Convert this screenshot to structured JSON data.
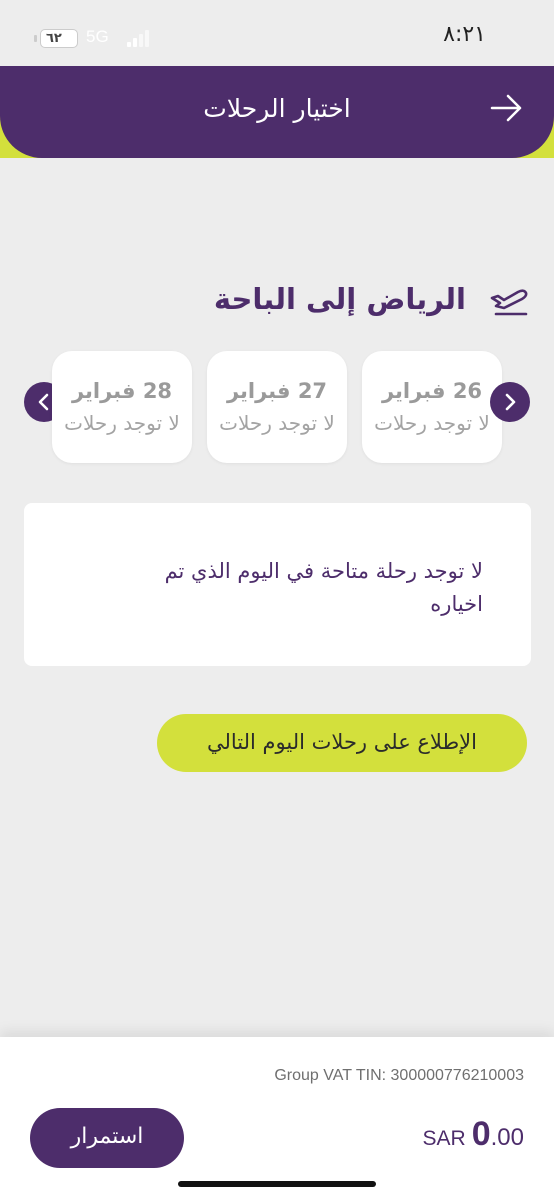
{
  "status_bar": {
    "time": "٨:٢١",
    "battery": "٦٢",
    "network": "5G"
  },
  "header": {
    "title": "اختيار الرحلات",
    "back_icon": "arrow-right-icon"
  },
  "route": {
    "title": "الرياض إلى الباحة",
    "icon": "plane-departure-icon"
  },
  "dates": [
    {
      "date": "26 فبراير",
      "status": "لا توجد رحلات"
    },
    {
      "date": "27 فبراير",
      "status": "لا توجد رحلات"
    },
    {
      "date": "28 فبراير",
      "status": "لا توجد رحلات"
    }
  ],
  "message": "لا توجد رحلة متاحة في اليوم الذي تم اخياره",
  "next_day_button": "الإطلاع على رحلات اليوم التالي",
  "footer": {
    "vat": "Group VAT TIN: 300000776210003",
    "currency": "SAR",
    "price_int": "0",
    "price_dec": ".00",
    "continue_label": "استمرار"
  },
  "colors": {
    "primary": "#4d2d6b",
    "accent": "#d3e03c",
    "background": "#ededed"
  }
}
